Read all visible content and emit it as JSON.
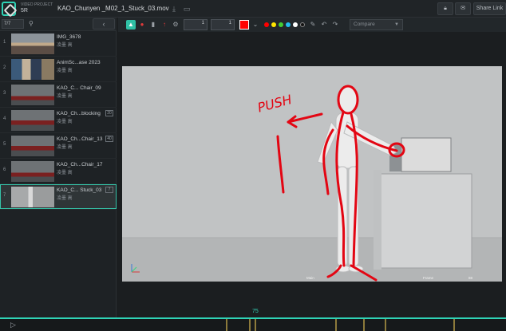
{
  "header": {
    "project_label": "VIDEO PROJECT",
    "project_name": "5R",
    "filename": "KAO_Chunyen _M02_1_Stuck_03.mov",
    "share_label": "Share Link"
  },
  "sidebar": {
    "count": "7/7",
    "items": [
      {
        "num": "1",
        "title": "IMG_3678",
        "user": "凌墨 高",
        "badge": ""
      },
      {
        "num": "2",
        "title": "AnimSc...ase 2023",
        "user": "凌墨 高",
        "badge": ""
      },
      {
        "num": "3",
        "title": "KAO_C... Chair_09",
        "user": "凌墨 高",
        "badge": ""
      },
      {
        "num": "4",
        "title": "KAO_Ch...blocking",
        "user": "凌墨 高",
        "badge": "20"
      },
      {
        "num": "5",
        "title": "KAO_Ch...Chair_13",
        "user": "凌墨 高",
        "badge": "40"
      },
      {
        "num": "6",
        "title": "KAO_Ch...Chair_17",
        "user": "凌墨 高",
        "badge": ""
      },
      {
        "num": "7",
        "title": "KAO_C... Stuck_03",
        "user": "凌墨 高",
        "badge": "7"
      }
    ]
  },
  "toolbar": {
    "opacity_value": "1",
    "brush_value": "1",
    "compare_label": "Compare",
    "colors": [
      "#ff0000",
      "#ffe600",
      "#44cc33",
      "#22bbee",
      "#ffffff",
      "#111111"
    ]
  },
  "viewer": {
    "annotation_text": "PUSH",
    "label_left": "Main",
    "label_mid": "Frame",
    "label_right": "88"
  },
  "timeline": {
    "current_frame": "75"
  }
}
